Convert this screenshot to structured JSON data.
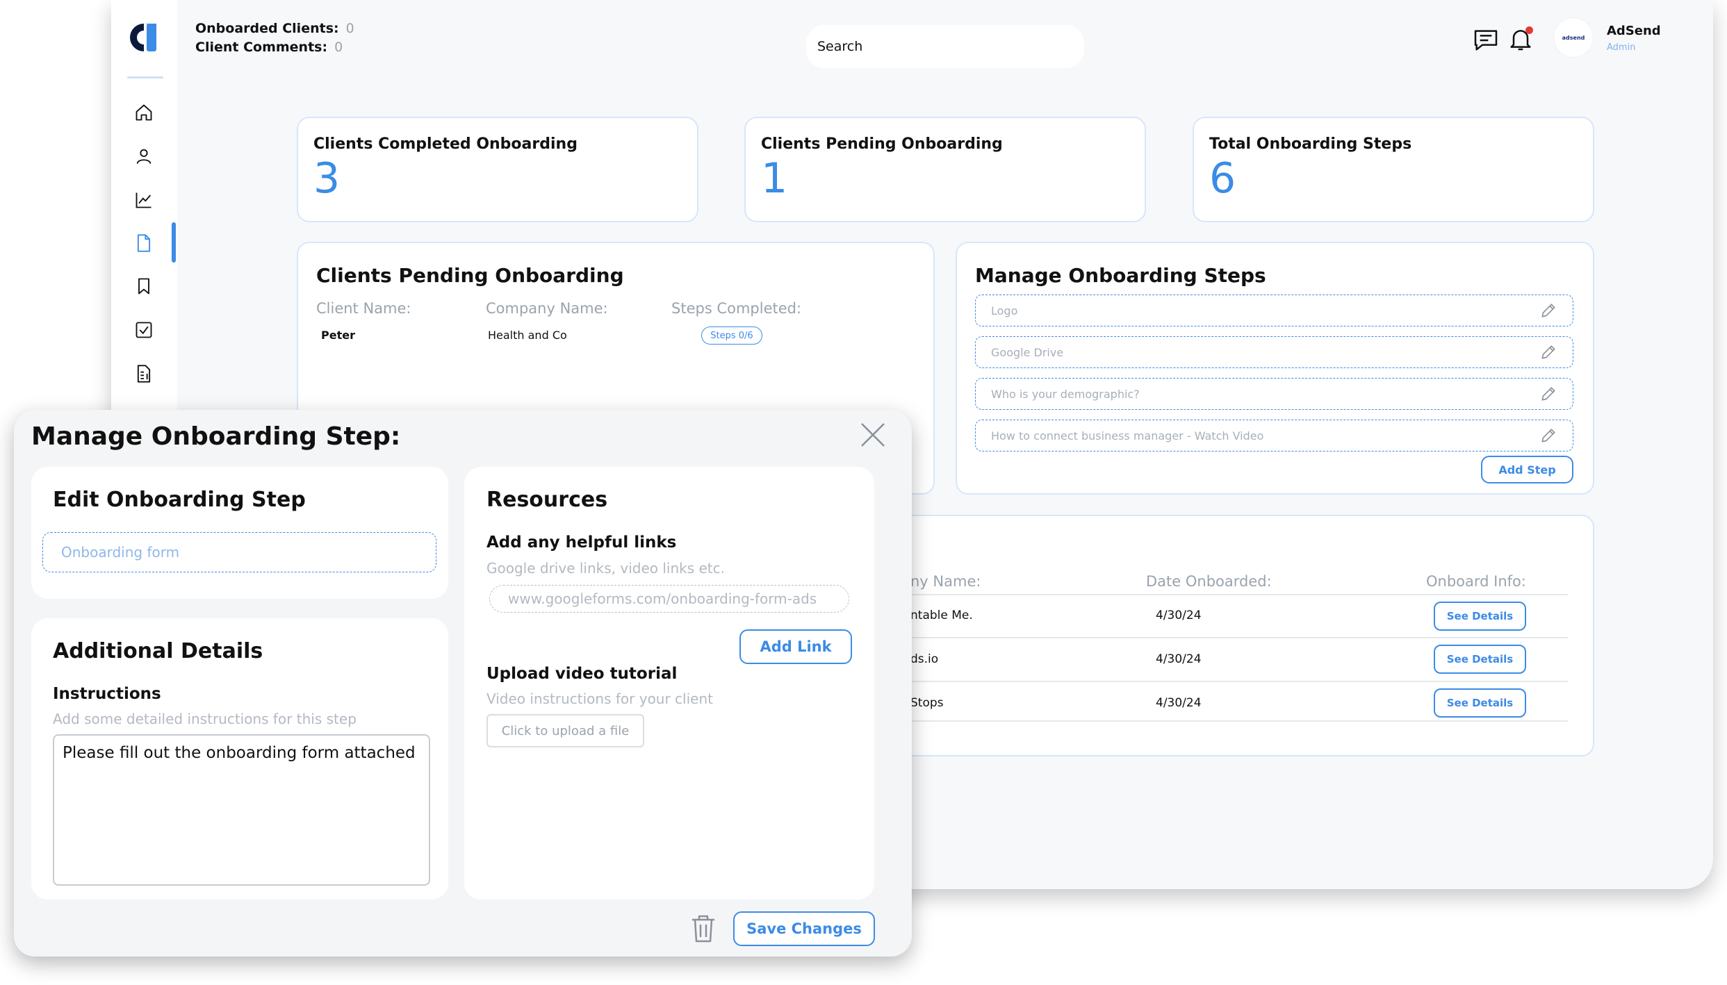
{
  "header": {
    "onboarded_clients_label": "Onboarded Clients:",
    "onboarded_clients_value": "0",
    "client_comments_label": "Client Comments:",
    "client_comments_value": "0",
    "search_placeholder": "Search",
    "user_name": "AdSend",
    "user_role": "Admin",
    "avatar_text": "adsend"
  },
  "sidebar": {
    "items": [
      "home-icon",
      "user-icon",
      "chart-icon",
      "document-icon",
      "bookmark-icon",
      "checkbox-icon",
      "invoice-icon"
    ],
    "active": "document-icon"
  },
  "stats": [
    {
      "title": "Clients Completed Onboarding",
      "value": "3"
    },
    {
      "title": "Clients Pending Onboarding",
      "value": "1"
    },
    {
      "title": "Total Onboarding Steps",
      "value": "6"
    }
  ],
  "pending": {
    "title": "Clients Pending Onboarding",
    "columns": [
      "Client Name:",
      "Company Name:",
      "Steps Completed:"
    ],
    "row": {
      "client": "Peter",
      "company": "Health and Co",
      "steps": "Steps 0/6"
    }
  },
  "manage_steps": {
    "title": "Manage Onboarding Steps",
    "steps": [
      "Logo",
      "Google Drive",
      "Who is your demographic?",
      "How to connect business manager - Watch Video"
    ],
    "add_button": "Add Step"
  },
  "onboarded_table": {
    "columns": [
      "ny Name:",
      "Date Onboarded:",
      "Onboard Info:"
    ],
    "rows": [
      {
        "company": "ntable Me.",
        "date": "4/30/24",
        "action": "See Details"
      },
      {
        "company": "ds.io",
        "date": "4/30/24",
        "action": "See Details"
      },
      {
        "company": "Stops",
        "date": "4/30/24",
        "action": "See Details"
      }
    ]
  },
  "modal": {
    "title": "Manage Onboarding Step:",
    "edit": {
      "title": "Edit Onboarding Step",
      "value": "Onboarding form"
    },
    "additional": {
      "title": "Additional Details",
      "instructions_label": "Instructions",
      "instructions_hint": "Add some detailed instructions for this step",
      "instructions_value": "Please fill out the onboarding form attached"
    },
    "resources": {
      "title": "Resources",
      "links_label": "Add any helpful links",
      "links_hint": "Google drive links, video links etc.",
      "link_placeholder": "www.googleforms.com/onboarding-form-ads",
      "add_link": "Add Link",
      "video_label": "Upload video tutorial",
      "video_hint": "Video instructions for your client",
      "upload_button": "Click to upload a file"
    },
    "save_button": "Save Changes"
  },
  "colors": {
    "accent": "#3c8be6",
    "border": "#d6e7fb",
    "muted": "#9aa3ad"
  }
}
